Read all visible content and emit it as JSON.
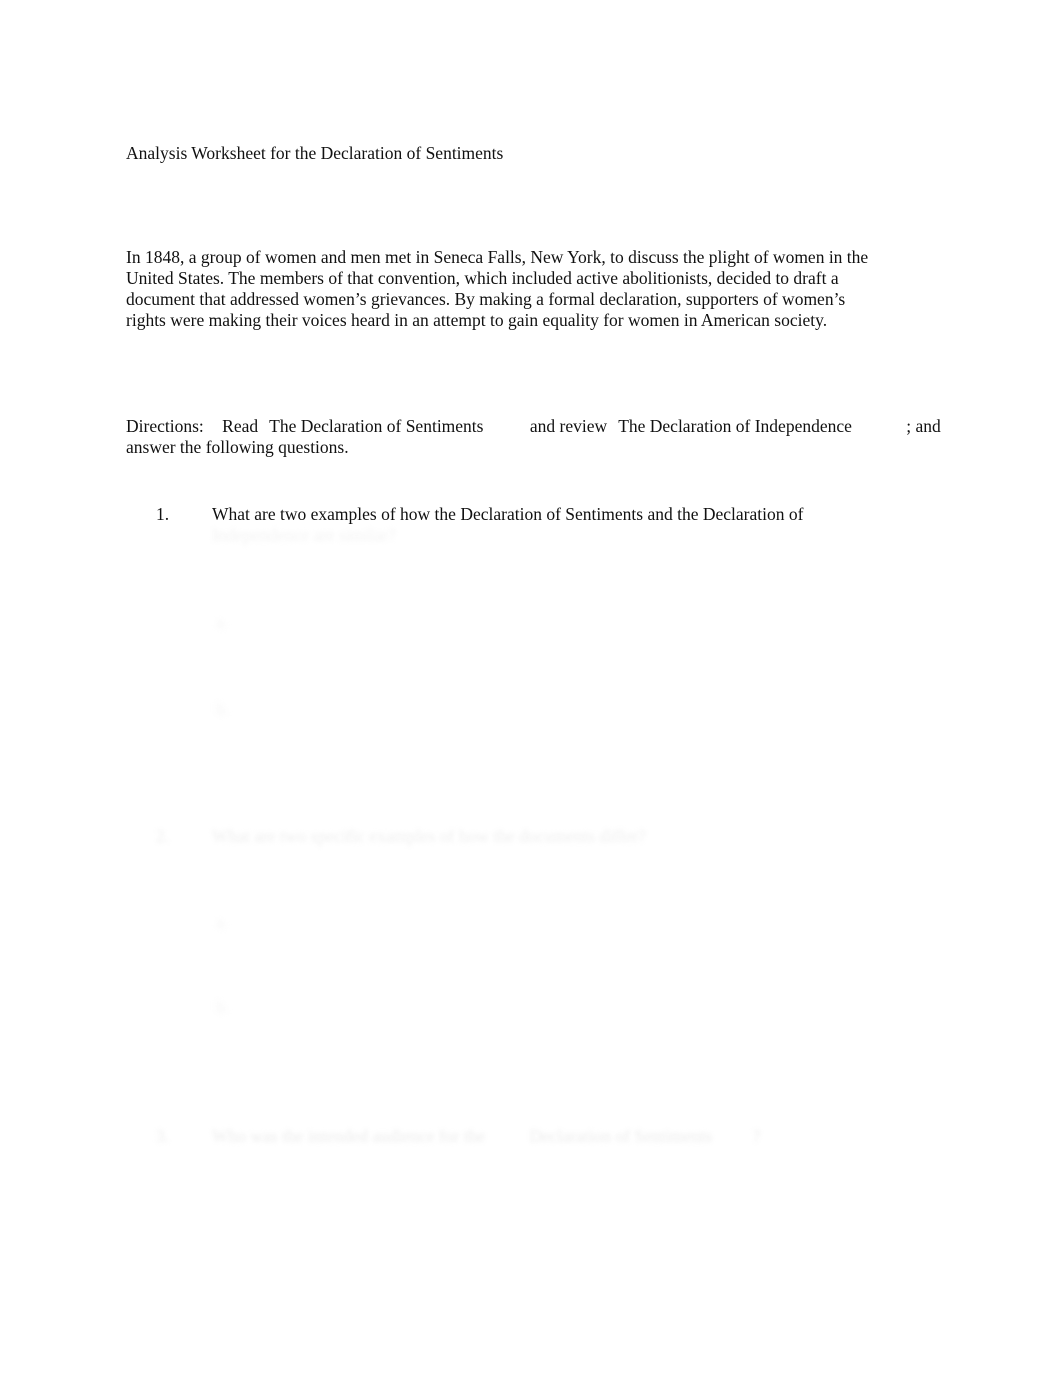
{
  "document": {
    "title": "Analysis Worksheet for the Declaration of Sentiments",
    "intro_paragraph": "In 1848, a group of women and men met in Seneca Falls, New York, to discuss the plight of women in the United States. The members of that convention, which included active abolitionists, decided to draft a document that addressed women’s grievances. By making a formal declaration, supporters of women’s rights were making their voices heard in an attempt to gain equality for women in American society."
  },
  "directions": {
    "label": "Directions:",
    "read_verb": "Read",
    "source_title_1": "The Declaration of Sentiments",
    "connector": "and review",
    "source_title_2": "The Declaration of Independence",
    "punctuation": ";",
    "closing": "and answer the following questions."
  },
  "questions": [
    {
      "number": "1.",
      "line_1": "What are two examples of how the",
      "title_1": "Declaration of Sentiments",
      "mid": "and the",
      "title_2": "Declaration of",
      "line_2": "Independence",
      "line_2_tail": "are similar?",
      "sub_items": [
        {
          "marker": "a."
        },
        {
          "marker": "b."
        }
      ]
    },
    {
      "number": "2.",
      "text": "What are two specific examples of how the documents differ?",
      "sub_items": [
        {
          "marker": "a."
        },
        {
          "marker": "b."
        }
      ]
    },
    {
      "number": "3.",
      "lead": "Who was the intended audience for the",
      "title": "Declaration of Sentiments",
      "tail": "?"
    }
  ]
}
